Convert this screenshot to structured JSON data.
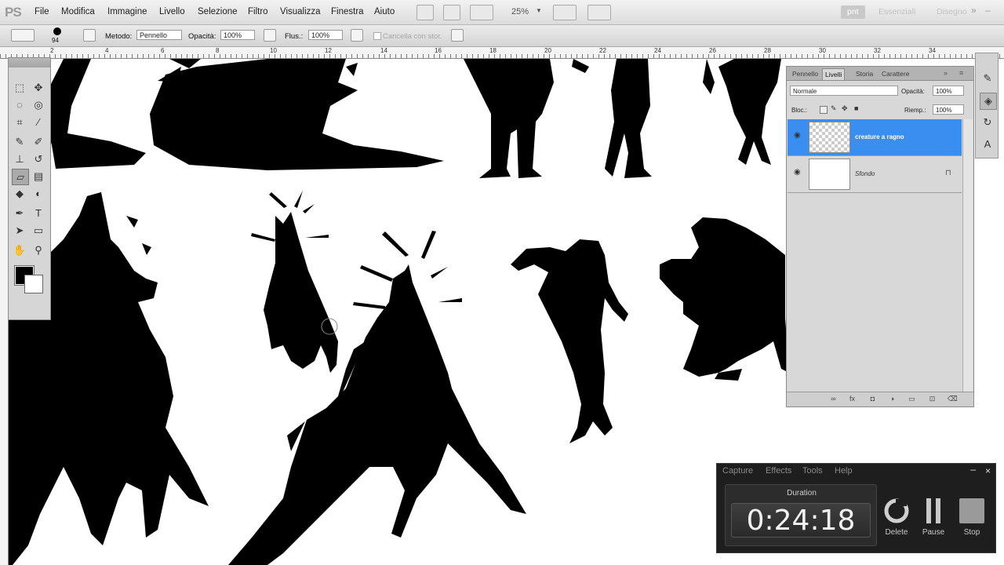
{
  "app": {
    "logo": "PS"
  },
  "menu": [
    "File",
    "Modifica",
    "Immagine",
    "Livello",
    "Selezione",
    "Filtro",
    "Visualizza",
    "Finestra",
    "Aiuto"
  ],
  "toolbar": {
    "zoom": "25%"
  },
  "workspaces": [
    {
      "label": "pnt",
      "active": true
    },
    {
      "label": "Essenziali",
      "active": false
    },
    {
      "label": "Disegno",
      "active": false
    }
  ],
  "window_controls": {
    "more": "»",
    "minimize": "–",
    "maximize": "□",
    "close": "×"
  },
  "options": {
    "brush_size": "94",
    "mode_label": "Metodo:",
    "mode_value": "Pennello",
    "opacity_label": "Opacità:",
    "opacity_value": "100%",
    "flow_label": "Flus.:",
    "flow_value": "100%",
    "erase_history": "Cancella con stor."
  },
  "ruler": {
    "h_ticks": [
      "2",
      "4",
      "6",
      "8",
      "10",
      "12",
      "14",
      "16",
      "18",
      "20",
      "22",
      "24",
      "26",
      "28",
      "30",
      "32",
      "34"
    ]
  },
  "layers_panel": {
    "tabs": [
      "Pennello",
      "Livelli",
      "Storia",
      "Carattere"
    ],
    "active_tab": "Livelli",
    "blend_mode": "Normale",
    "opacity_label": "Opacità:",
    "opacity_value": "100%",
    "lock_label": "Bloc.:",
    "fill_label": "Riemp.:",
    "fill_value": "100%",
    "layers": [
      {
        "name": "creature a ragno",
        "selected": true,
        "visible": true
      },
      {
        "name": "Sfondo",
        "selected": false,
        "visible": true,
        "locked": true
      }
    ]
  },
  "recorder": {
    "menu": [
      "Capture",
      "Effects",
      "Tools",
      "Help"
    ],
    "duration_label": "Duration",
    "duration": "0:24:18",
    "buttons": [
      {
        "label": "Delete",
        "icon": "delete-icon"
      },
      {
        "label": "Pause",
        "icon": "pause-icon"
      },
      {
        "label": "Stop",
        "icon": "stop-icon"
      }
    ]
  },
  "colors": {
    "accent": "#3a8ef0",
    "foreground": "#000000",
    "background": "#ffffff"
  }
}
